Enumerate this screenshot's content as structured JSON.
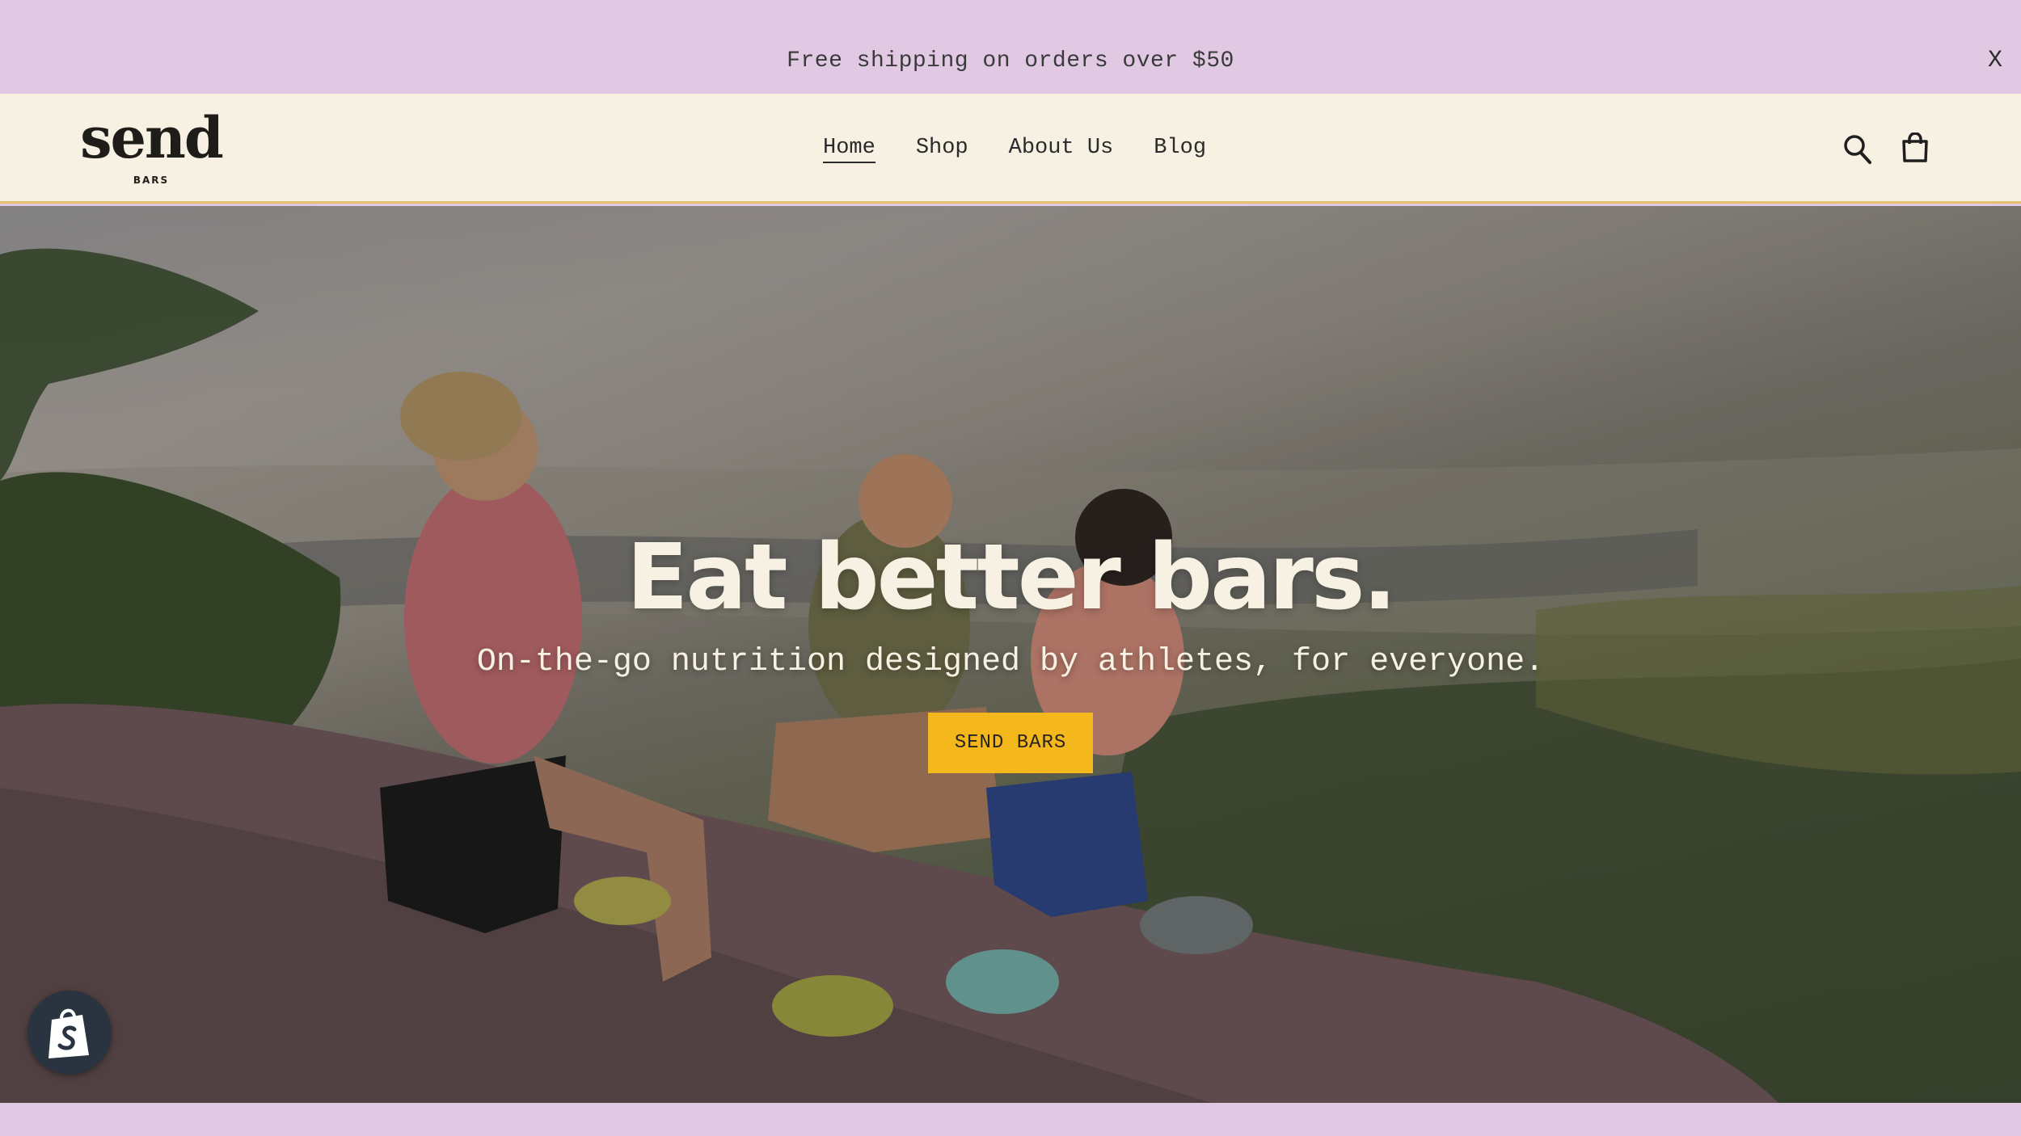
{
  "announcement": {
    "text": "Free shipping on orders over $50",
    "close_label": "X"
  },
  "header": {
    "logo": {
      "word": "send",
      "sub": "BARS"
    },
    "nav": [
      {
        "label": "Home",
        "active": true
      },
      {
        "label": "Shop",
        "active": false
      },
      {
        "label": "About Us",
        "active": false
      },
      {
        "label": "Blog",
        "active": false
      }
    ],
    "icons": [
      "search-icon",
      "cart-icon"
    ]
  },
  "hero": {
    "title": "Eat better bars.",
    "subtitle": "On-the-go nutrition designed by athletes, for everyone.",
    "button_label": "SEND BARS"
  },
  "badge": {
    "icon": "shopify-bag-icon"
  },
  "colors": {
    "announcement_bg": "#e1c9e4",
    "header_bg": "#f6f1e2",
    "accent_button": "#f5b81c",
    "hero_text": "#f7f1e3"
  }
}
